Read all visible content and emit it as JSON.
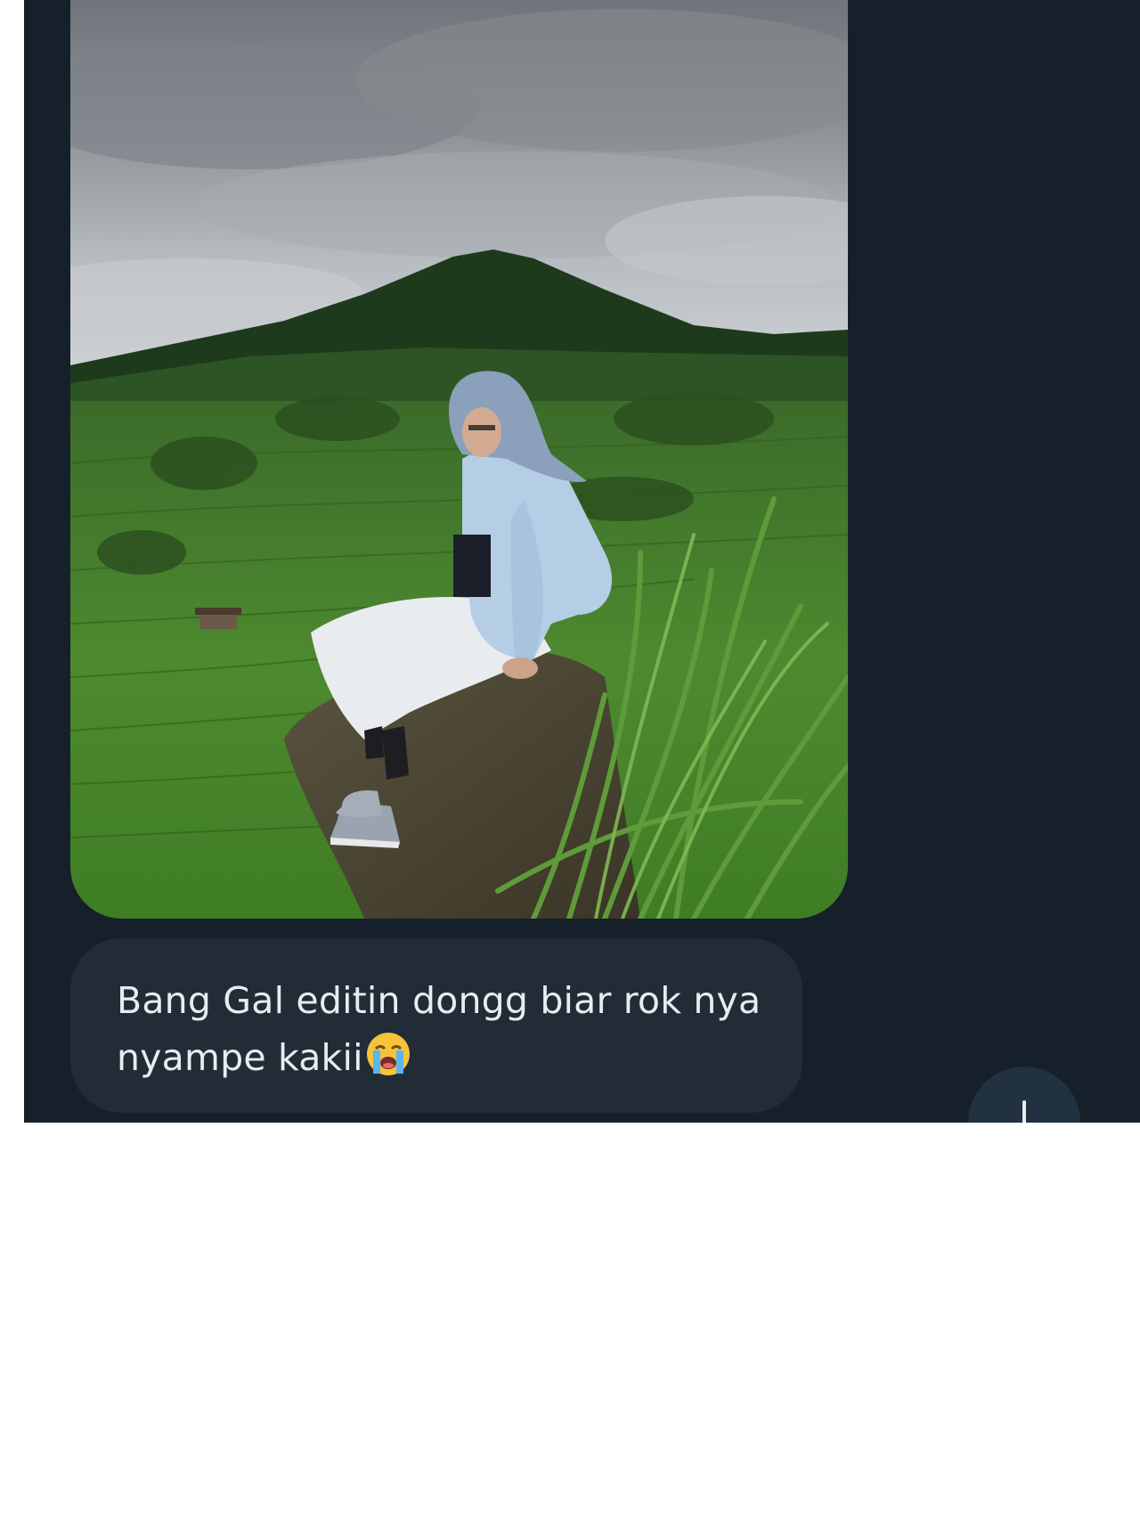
{
  "theme": {
    "background": "#15202b",
    "bubble": "#222c37",
    "text": "#e7ecef"
  },
  "message": {
    "image_alt": "",
    "text": "Bang Gal editin dongg biar rok nya nyampe kakii",
    "emoji": "loudly-crying-face-emoji"
  },
  "scroll_button": {
    "icon": "arrow-down-icon"
  }
}
